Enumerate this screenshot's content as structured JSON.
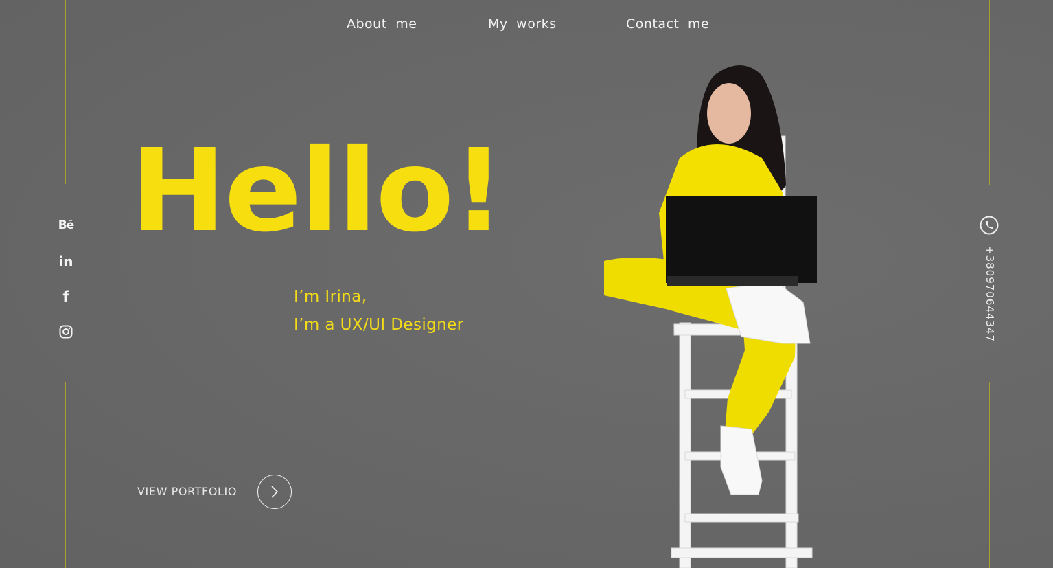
{
  "nav": {
    "about": "About me",
    "works": "My works",
    "contact": "Contact me"
  },
  "social": [
    "behance-icon",
    "linkedin-icon",
    "facebook-icon",
    "instagram-icon"
  ],
  "hero": {
    "greeting": "Hello!",
    "line1": "I’m Irina,",
    "line2": "I’m a UX/UI Designer"
  },
  "cta": {
    "label": "VIEW PORTFOLIO"
  },
  "contact": {
    "phone": "+380970644347"
  },
  "colors": {
    "background": "#676767",
    "accent": "#f7de0f",
    "line": "#a99f2e",
    "text": "#f2f2f2"
  }
}
